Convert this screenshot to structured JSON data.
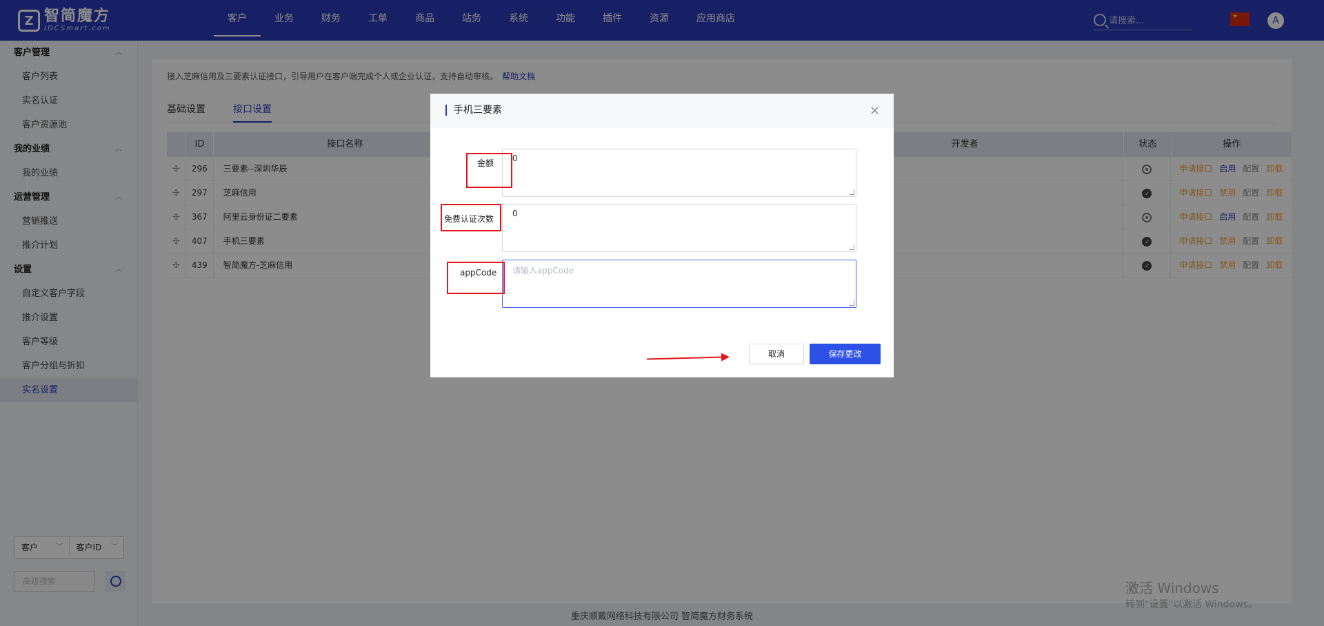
{
  "brand": {
    "logo_mark": "Z",
    "title": "智简魔方",
    "subtitle": "IDCSmart.com"
  },
  "nav": [
    "客户",
    "业务",
    "财务",
    "工单",
    "商品",
    "站务",
    "系统",
    "功能",
    "插件",
    "资源",
    "应用商店"
  ],
  "search": {
    "placeholder": "请搜索..."
  },
  "avatar": "A",
  "sidebar": {
    "groups": [
      {
        "title": "客户管理",
        "items": [
          "客户列表",
          "实名认证",
          "客户资源池"
        ]
      },
      {
        "title": "我的业绩",
        "items": [
          "我的业绩"
        ]
      },
      {
        "title": "运营管理",
        "items": [
          "营销推送",
          "推介计划"
        ]
      },
      {
        "title": "设置",
        "items": [
          "自定义客户字段",
          "推介设置",
          "客户等级",
          "客户分组与折扣",
          "实名设置"
        ]
      }
    ],
    "filter": {
      "left": "客户",
      "right": "客户ID"
    },
    "adv_search_placeholder": "高级搜索"
  },
  "main": {
    "description": "接入芝麻信用及三要素认证接口，引导用户在客户端完成个人或企业认证，支持自动审核。",
    "help_link": "帮助文档",
    "tabs": [
      "基础设置",
      "接口设置"
    ],
    "table": {
      "headers": [
        "ID",
        "接口名称",
        "开发者",
        "状态",
        "操作"
      ],
      "rows": [
        {
          "id": "296",
          "name": "三要素--深圳华辰",
          "status": "off",
          "toggle": "启用"
        },
        {
          "id": "297",
          "name": "芝麻信用",
          "status": "on",
          "toggle": "禁用"
        },
        {
          "id": "367",
          "name": "阿里云身份证二要素",
          "status": "off",
          "toggle": "启用"
        },
        {
          "id": "407",
          "name": "手机三要素",
          "status": "on",
          "toggle": "禁用"
        },
        {
          "id": "439",
          "name": "智简魔方-芝麻信用",
          "status": "on",
          "toggle": "禁用"
        }
      ],
      "ops": {
        "apply": "申请接口",
        "config": "配置",
        "uninstall": "卸载"
      }
    }
  },
  "footer": "重庆顺戴网络科技有限公司 智简魔方财务系统",
  "watermark": {
    "line1": "激活 Windows",
    "line2": "转到\"设置\"以激活 Windows。"
  },
  "dialog": {
    "title": "手机三要素",
    "close": "×",
    "fields": [
      {
        "label": "金额",
        "value": "0",
        "placeholder": ""
      },
      {
        "label": "免费认证次数",
        "value": "0",
        "placeholder": ""
      },
      {
        "label": "appCode",
        "value": "",
        "placeholder": "请输入appCode"
      }
    ],
    "cancel": "取消",
    "save": "保存更改"
  },
  "colors": {
    "nav_bg": "#2b3bb7",
    "primary": "#2d50e6",
    "annotation_red": "#e4131c",
    "warn": "#f0a040"
  }
}
